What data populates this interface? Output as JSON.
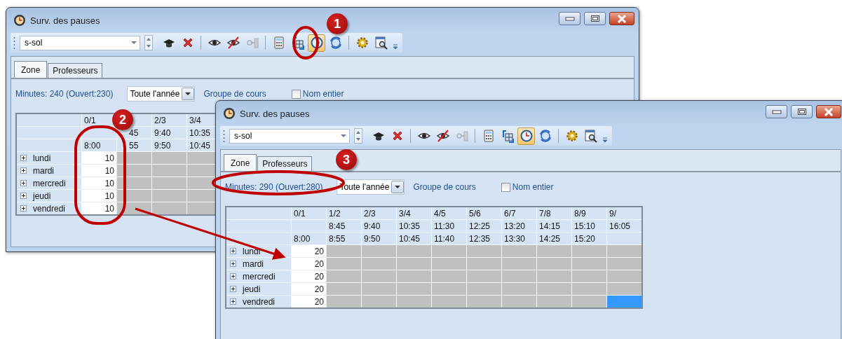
{
  "windows": [
    {
      "title": "Surv. des pauses",
      "combo": {
        "value": "s-sol"
      },
      "tool_groups": [
        [
          {
            "kind": "graduation",
            "selected": false,
            "disabled": false
          },
          {
            "kind": "delete",
            "selected": false,
            "disabled": false
          }
        ],
        [
          {
            "kind": "eye",
            "selected": false,
            "disabled": false
          },
          {
            "kind": "eye-off",
            "selected": false,
            "disabled": false
          },
          {
            "kind": "key",
            "selected": false,
            "disabled": true
          }
        ],
        [
          {
            "kind": "calculator",
            "selected": false,
            "disabled": false
          },
          {
            "kind": "table-swap",
            "selected": false,
            "disabled": false
          },
          {
            "kind": "clock",
            "selected": true,
            "disabled": false
          },
          {
            "kind": "clock-refresh",
            "selected": false,
            "disabled": false
          }
        ],
        [
          {
            "kind": "gear",
            "selected": false,
            "disabled": false
          },
          {
            "kind": "preview",
            "selected": false,
            "disabled": false
          }
        ]
      ],
      "tabs": [
        {
          "label": "Zone",
          "selected": true
        },
        {
          "label": "Professeurs",
          "selected": false
        }
      ],
      "filters": {
        "minutes": "Minutes: 240 (Ouvert:230)",
        "period": {
          "value": "Toute l'année"
        },
        "group_link": "Groupe de cours",
        "full_name": {
          "label": "Nom entier",
          "checked": false
        }
      },
      "table": {
        "columns": [
          {
            "period": "0/1",
            "end": "8:00",
            "covered": false
          },
          {
            "start": "45",
            "end": "55",
            "covered": true
          },
          {
            "period": "2/3",
            "start": "9:40",
            "end": "9:50",
            "covered": false
          },
          {
            "period": "3/4",
            "start": "10:35",
            "end": "10:45",
            "covered": false
          }
        ],
        "rows": [
          {
            "day": "lundi",
            "expanded": false,
            "cells": [
              {
                "kind": "open",
                "value": "10",
                "selected": false
              },
              {
                "kind": "closed",
                "selected": false
              },
              {
                "kind": "closed",
                "selected": false
              },
              {
                "kind": "closed",
                "selected": false
              }
            ]
          },
          {
            "day": "mardi",
            "expanded": false,
            "cells": [
              {
                "kind": "open",
                "value": "10",
                "selected": false
              },
              {
                "kind": "closed",
                "selected": false
              },
              {
                "kind": "closed",
                "selected": false
              },
              {
                "kind": "closed",
                "selected": false
              }
            ]
          },
          {
            "day": "mercredi",
            "expanded": false,
            "cells": [
              {
                "kind": "open",
                "value": "10",
                "selected": false
              },
              {
                "kind": "closed",
                "selected": false
              },
              {
                "kind": "closed",
                "selected": false
              },
              {
                "kind": "closed",
                "selected": false
              }
            ]
          },
          {
            "day": "jeudi",
            "expanded": false,
            "cells": [
              {
                "kind": "open",
                "value": "10",
                "selected": false
              },
              {
                "kind": "closed",
                "selected": false
              },
              {
                "kind": "closed",
                "selected": false
              },
              {
                "kind": "closed",
                "selected": false
              }
            ]
          },
          {
            "day": "vendredi",
            "expanded": false,
            "cells": [
              {
                "kind": "open",
                "value": "10",
                "selected": false
              },
              {
                "kind": "closed",
                "selected": false
              },
              {
                "kind": "closed",
                "selected": false
              },
              {
                "kind": "closed",
                "selected": false
              }
            ]
          }
        ]
      }
    },
    {
      "title": "Surv. des pauses",
      "combo": {
        "value": "s-sol"
      },
      "tool_groups": [
        [
          {
            "kind": "graduation",
            "selected": false,
            "disabled": false
          },
          {
            "kind": "delete",
            "selected": false,
            "disabled": false
          }
        ],
        [
          {
            "kind": "eye",
            "selected": false,
            "disabled": false
          },
          {
            "kind": "eye-off",
            "selected": false,
            "disabled": false
          },
          {
            "kind": "key",
            "selected": false,
            "disabled": true
          }
        ],
        [
          {
            "kind": "calculator",
            "selected": false,
            "disabled": false
          },
          {
            "kind": "table-swap",
            "selected": false,
            "disabled": false
          },
          {
            "kind": "clock",
            "selected": true,
            "disabled": false
          },
          {
            "kind": "clock-refresh",
            "selected": false,
            "disabled": false
          }
        ],
        [
          {
            "kind": "gear",
            "selected": false,
            "disabled": false
          },
          {
            "kind": "preview",
            "selected": false,
            "disabled": false
          }
        ]
      ],
      "tabs": [
        {
          "label": "Zone",
          "selected": true
        },
        {
          "label": "Professeurs",
          "selected": false
        }
      ],
      "filters": {
        "minutes": "Minutes: 290 (Ouvert:280)",
        "period": {
          "value": "Toute l'année"
        },
        "group_link": "Groupe de cours",
        "full_name": {
          "label": "Nom entier",
          "checked": false
        }
      },
      "table": {
        "columns": [
          {
            "period": "0/1",
            "end": "8:00",
            "covered": false
          },
          {
            "period": "1/2",
            "start": "8:45",
            "end": "8:55",
            "covered": false
          },
          {
            "period": "2/3",
            "start": "9:40",
            "end": "9:50",
            "covered": false
          },
          {
            "period": "3/4",
            "start": "10:35",
            "end": "10:45",
            "covered": false
          },
          {
            "period": "4/5",
            "start": "11:30",
            "end": "11:40",
            "covered": false
          },
          {
            "period": "5/6",
            "start": "12:25",
            "end": "12:35",
            "covered": false
          },
          {
            "period": "6/7",
            "start": "13:20",
            "end": "13:30",
            "covered": false
          },
          {
            "period": "7/8",
            "start": "14:15",
            "end": "14:25",
            "covered": false
          },
          {
            "period": "8/9",
            "start": "15:10",
            "end": "15:20",
            "covered": false
          },
          {
            "period": "9/",
            "start": "16:05",
            "covered": false
          }
        ],
        "rows": [
          {
            "day": "lundi",
            "expanded": false,
            "cells": [
              {
                "kind": "open",
                "value": "20",
                "selected": false
              },
              {
                "kind": "closed",
                "selected": false
              },
              {
                "kind": "closed",
                "selected": false
              },
              {
                "kind": "closed",
                "selected": false
              },
              {
                "kind": "closed",
                "selected": false
              },
              {
                "kind": "closed",
                "selected": false
              },
              {
                "kind": "closed",
                "selected": false
              },
              {
                "kind": "closed",
                "selected": false
              },
              {
                "kind": "closed",
                "selected": false
              },
              {
                "kind": "closed",
                "selected": false
              }
            ]
          },
          {
            "day": "mardi",
            "expanded": false,
            "cells": [
              {
                "kind": "open",
                "value": "20",
                "selected": false
              },
              {
                "kind": "closed",
                "selected": false
              },
              {
                "kind": "closed",
                "selected": false
              },
              {
                "kind": "closed",
                "selected": false
              },
              {
                "kind": "closed",
                "selected": false
              },
              {
                "kind": "closed",
                "selected": false
              },
              {
                "kind": "closed",
                "selected": false
              },
              {
                "kind": "closed",
                "selected": false
              },
              {
                "kind": "closed",
                "selected": false
              },
              {
                "kind": "closed",
                "selected": false
              }
            ]
          },
          {
            "day": "mercredi",
            "expanded": false,
            "cells": [
              {
                "kind": "open",
                "value": "20",
                "selected": false
              },
              {
                "kind": "closed",
                "selected": false
              },
              {
                "kind": "closed",
                "selected": false
              },
              {
                "kind": "closed",
                "selected": false
              },
              {
                "kind": "closed",
                "selected": false
              },
              {
                "kind": "closed",
                "selected": false
              },
              {
                "kind": "closed",
                "selected": false
              },
              {
                "kind": "closed",
                "selected": false
              },
              {
                "kind": "closed",
                "selected": false
              },
              {
                "kind": "closed",
                "selected": false
              }
            ]
          },
          {
            "day": "jeudi",
            "expanded": false,
            "cells": [
              {
                "kind": "open",
                "value": "20",
                "selected": false
              },
              {
                "kind": "closed",
                "selected": false
              },
              {
                "kind": "closed",
                "selected": false
              },
              {
                "kind": "closed",
                "selected": false
              },
              {
                "kind": "closed",
                "selected": false
              },
              {
                "kind": "closed",
                "selected": false
              },
              {
                "kind": "closed",
                "selected": false
              },
              {
                "kind": "closed",
                "selected": false
              },
              {
                "kind": "closed",
                "selected": false
              },
              {
                "kind": "closed",
                "selected": false
              }
            ]
          },
          {
            "day": "vendredi",
            "expanded": false,
            "cells": [
              {
                "kind": "open",
                "value": "20",
                "selected": false
              },
              {
                "kind": "closed",
                "selected": false
              },
              {
                "kind": "closed",
                "selected": false
              },
              {
                "kind": "closed",
                "selected": false
              },
              {
                "kind": "closed",
                "selected": false
              },
              {
                "kind": "closed",
                "selected": false
              },
              {
                "kind": "closed",
                "selected": false
              },
              {
                "kind": "closed",
                "selected": false
              },
              {
                "kind": "closed",
                "selected": false
              },
              {
                "kind": "closed",
                "selected": true
              }
            ]
          }
        ]
      }
    }
  ],
  "annotations": {
    "badges": [
      "1",
      "2",
      "3"
    ]
  }
}
